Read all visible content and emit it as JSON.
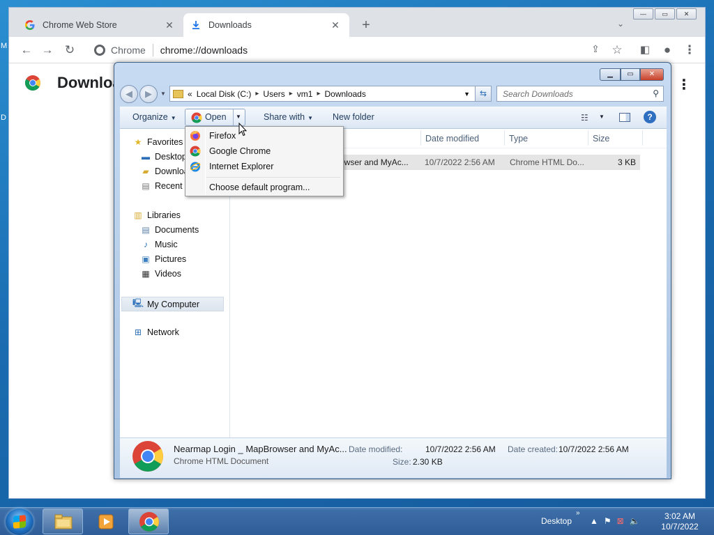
{
  "desktop": {
    "edge_glyph_1": "M",
    "edge_glyph_2": "D"
  },
  "chrome": {
    "tabs": [
      {
        "title": "Chrome Web Store",
        "icon": "google-g-icon"
      },
      {
        "title": "Downloads",
        "icon": "download-icon",
        "active": true
      }
    ],
    "omnibox": {
      "label": "Chrome",
      "url": "chrome://downloads"
    },
    "page_title": "Downloads"
  },
  "explorer": {
    "breadcrumb": [
      "Local Disk (C:)",
      "Users",
      "vm1",
      "Downloads"
    ],
    "breadcrumb_prefix": "«",
    "search_placeholder": "Search Downloads",
    "commands": {
      "organize": "Organize",
      "open": "Open",
      "share_with": "Share with",
      "new_folder": "New folder"
    },
    "open_menu": {
      "items": [
        "Firefox",
        "Google Chrome",
        "Internet Explorer"
      ],
      "default_program": "Choose default program..."
    },
    "nav": {
      "favorites": "Favorites",
      "desktop": "Desktop",
      "downloads": "Downloads",
      "recent": "Recent Places",
      "libraries": "Libraries",
      "documents": "Documents",
      "music": "Music",
      "pictures": "Pictures",
      "videos": "Videos",
      "my_computer": "My Computer",
      "network": "Network"
    },
    "columns": {
      "date_modified": "Date modified",
      "type": "Type",
      "size": "Size"
    },
    "file": {
      "name_visible": "rowser and MyAc...",
      "date_modified": "10/7/2022 2:56 AM",
      "type": "Chrome HTML Do...",
      "size": "3 KB"
    },
    "details": {
      "name": "Nearmap Login _ MapBrowser and MyAc...",
      "kind": "Chrome HTML Document",
      "date_modified_label": "Date modified:",
      "date_modified": "10/7/2022 2:56 AM",
      "date_created_label": "Date created:",
      "date_created": "10/7/2022 2:56 AM",
      "size_label": "Size:",
      "size": "2.30 KB"
    }
  },
  "taskbar": {
    "desktop_label": "Desktop",
    "chevron": "»",
    "time": "3:02 AM",
    "date": "10/7/2022"
  }
}
